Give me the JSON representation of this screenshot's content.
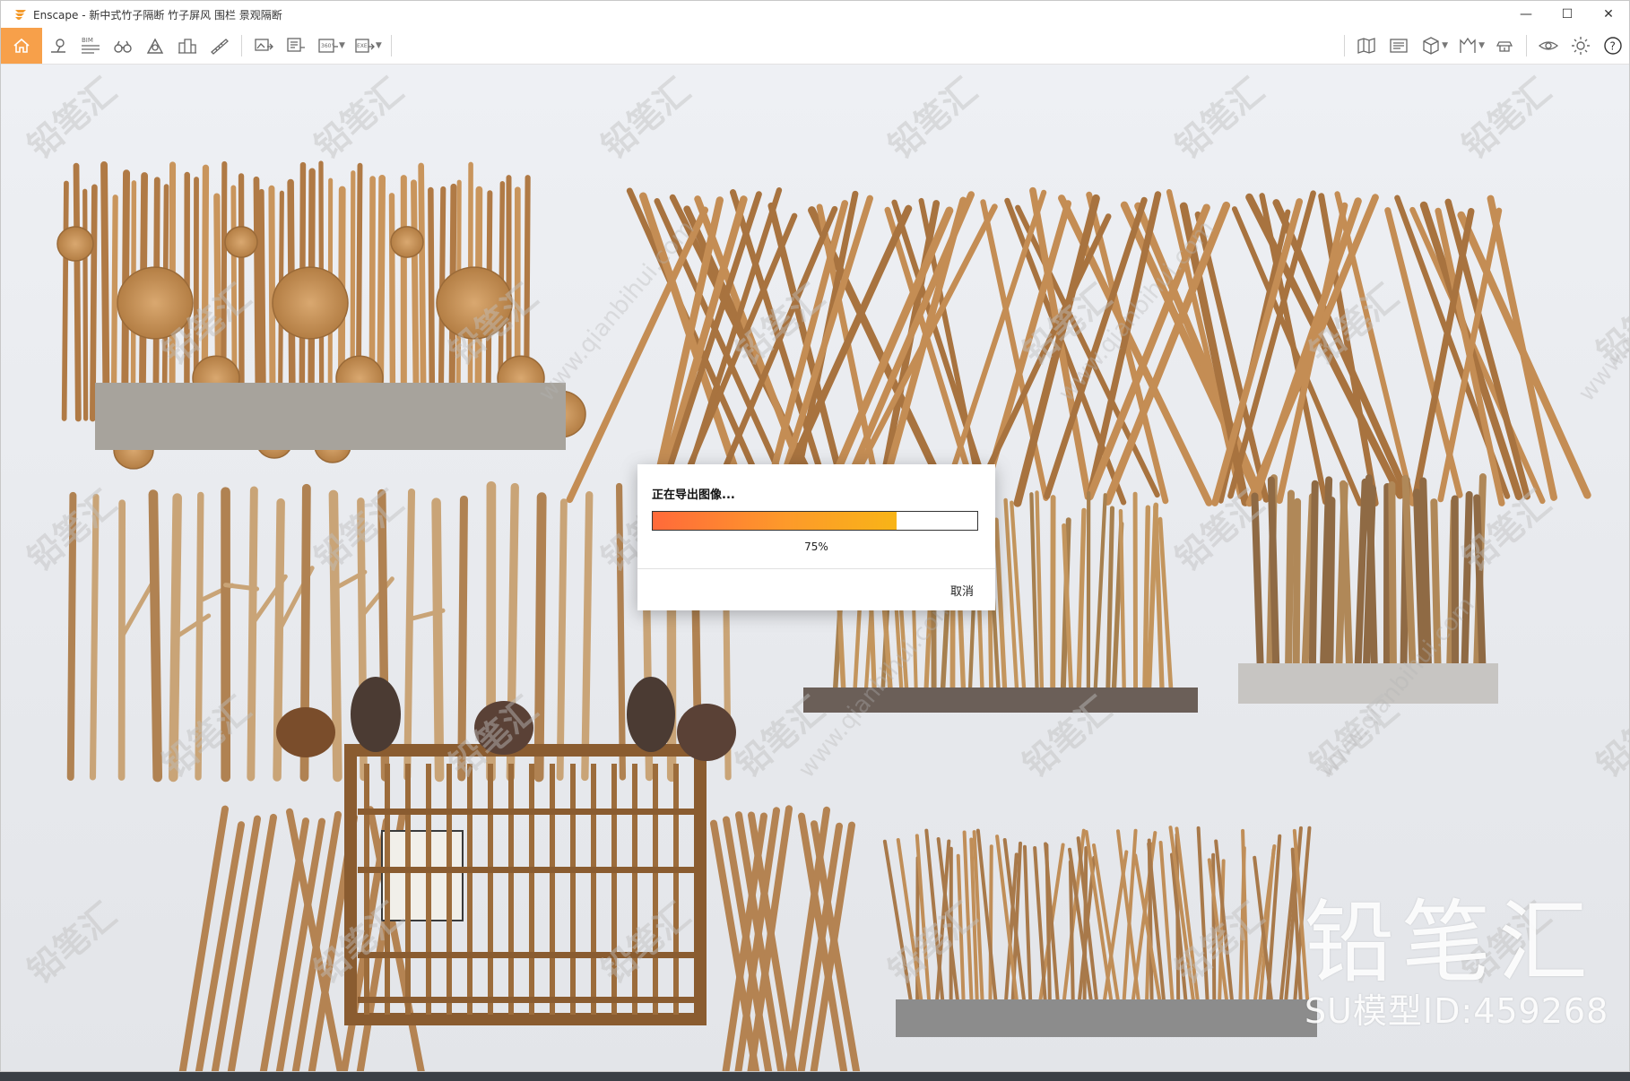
{
  "window": {
    "title": "Enscape - 新中式竹子隔断 竹子屏风 围栏 景观隔断",
    "controls": [
      "—",
      "☐",
      "✕"
    ]
  },
  "toolbar": {
    "bim_label": "BIM",
    "pano_label": "360°",
    "exe_label": "EXE",
    "help_label": "?"
  },
  "dialog": {
    "title": "正在导出图像...",
    "progress": 0.75,
    "progress_text": "75%",
    "cancel_label": "取消"
  },
  "brand": {
    "main": "铅笔汇",
    "sub": "SU模型ID:459268"
  },
  "watermark": {
    "text": "铅笔汇",
    "url": "www.qianbihui.com"
  },
  "colors": {
    "accent": "#f7a04a",
    "progress_start": "#ff6a3a",
    "progress_end": "#f8b417"
  }
}
